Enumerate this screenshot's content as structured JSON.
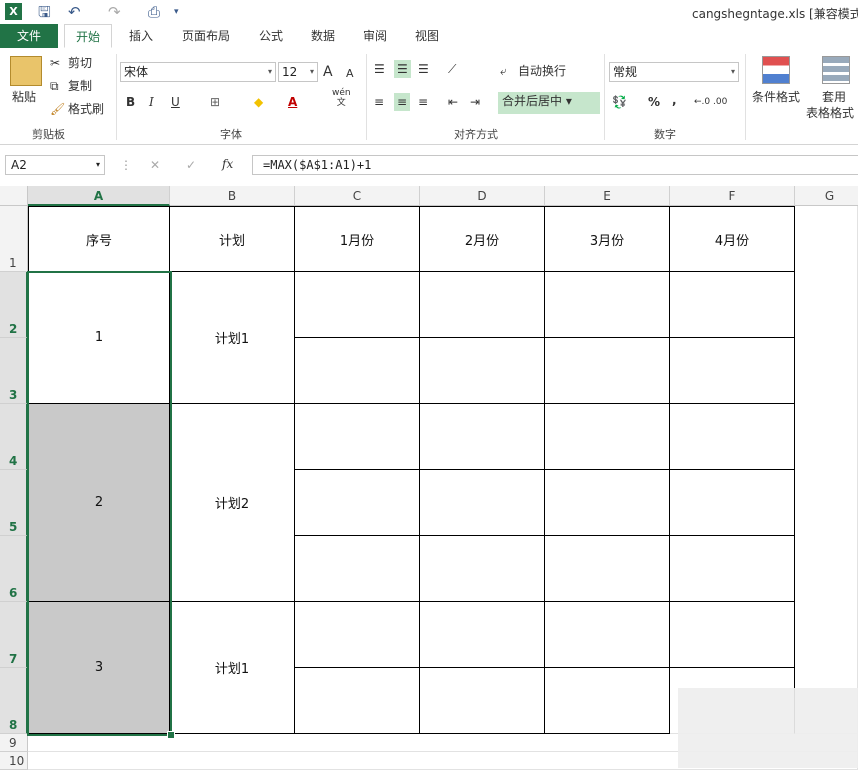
{
  "window": {
    "title": "cangshegntage.xls  [兼容模式"
  },
  "tabs": [
    "文件",
    "开始",
    "插入",
    "页面布局",
    "公式",
    "数据",
    "审阅",
    "视图"
  ],
  "ribbon": {
    "clipboard": {
      "paste": "粘贴",
      "cut": "剪切",
      "copy": "复制",
      "format_painter": "格式刷",
      "label": "剪贴板"
    },
    "font": {
      "name": "宋体",
      "size": "12",
      "grow": "A",
      "shrink": "A",
      "bold": "B",
      "italic": "I",
      "underline": "U",
      "wen": "wén",
      "wen2": "文",
      "label": "字体"
    },
    "align": {
      "wrap": "自动换行",
      "merge": "合并后居中",
      "label": "对齐方式"
    },
    "number": {
      "format": "常规",
      "percent": "%",
      "comma": ",",
      "inc_dec": "←.0 .00",
      "dec_dec": ".00 →.0",
      "label": "数字"
    },
    "styles": {
      "cond": "条件格式",
      "table1": "套用",
      "table2": "表格格式"
    }
  },
  "formula": {
    "namebox": "A2",
    "cancel": "✕",
    "enter": "✓",
    "fx": "fx",
    "value": "=MAX($A$1:A1)+1"
  },
  "columns": [
    "A",
    "B",
    "C",
    "D",
    "E",
    "F",
    "G"
  ],
  "rows": [
    "1",
    "2",
    "3",
    "4",
    "5",
    "6",
    "7",
    "8",
    "9",
    "10"
  ],
  "headers": [
    "序号",
    "计划",
    "1月份",
    "2月份",
    "3月份",
    "4月份"
  ],
  "groups": [
    {
      "seq": "1",
      "plan": "计划1"
    },
    {
      "seq": "2",
      "plan": "计划2"
    },
    {
      "seq": "3",
      "plan": "计划1"
    }
  ],
  "colors": {
    "accent": "#217346",
    "selected_fill": "#c9c9c9"
  }
}
